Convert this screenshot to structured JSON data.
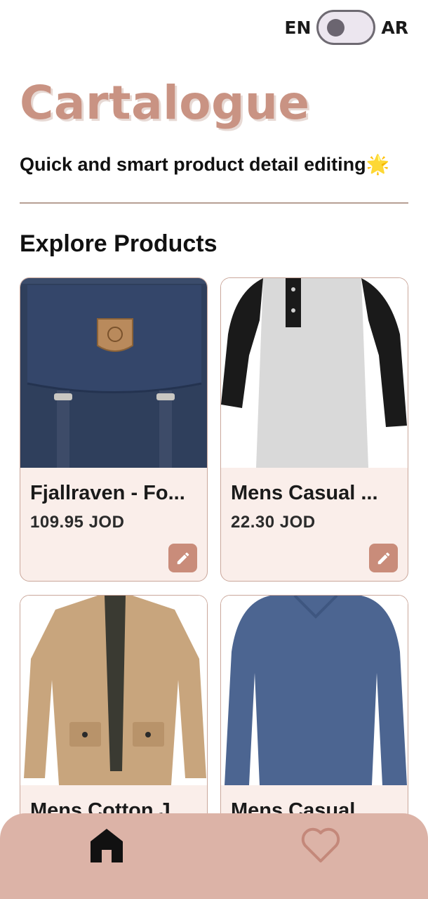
{
  "lang_toggle": {
    "left_label": "EN",
    "right_label": "AR"
  },
  "header": {
    "brand": "Cartalogue",
    "tagline": "Quick and smart product detail editing",
    "tagline_emoji": "🌟"
  },
  "section_title": "Explore Products",
  "products": [
    {
      "name": "Fjallraven - Fo...",
      "price": "109.95 JOD"
    },
    {
      "name": "Mens Casual ...",
      "price": "22.30 JOD"
    },
    {
      "name": "Mens Cotton J",
      "price": ""
    },
    {
      "name": "Mens Casual",
      "price": ""
    }
  ],
  "colors": {
    "brand": "#c99383",
    "card_bg": "#faeeea",
    "edit_button": "#c98c7a",
    "bottom_nav": "#dcb3a7",
    "favorite_icon": "#c4887a"
  },
  "icons": {
    "edit": "pencil-icon",
    "home": "home-icon",
    "favorites": "heart-icon"
  }
}
